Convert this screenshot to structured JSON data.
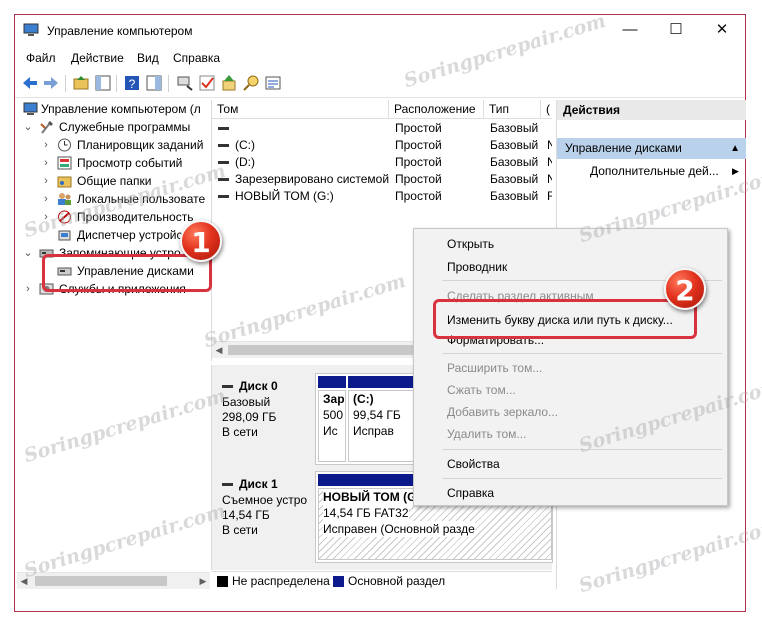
{
  "window": {
    "title": "Управление компьютером",
    "controls": {
      "minimize": "—",
      "maximize": "☐",
      "close": "✕"
    }
  },
  "menu": [
    "Файл",
    "Действие",
    "Вид",
    "Справка"
  ],
  "toolbar": {
    "icons": [
      "back-arrow-icon",
      "forward-arrow-icon",
      "up-folder-icon",
      "show-tree-icon",
      "help-icon",
      "show-pane-icon",
      "connect-icon",
      "check-icon",
      "export-icon",
      "search-icon",
      "properties-icon"
    ]
  },
  "tree": {
    "root": "Управление компьютером (л",
    "system_tools": "Служебные программы",
    "system_items": [
      "Планировщик заданий",
      "Просмотр событий",
      "Общие папки",
      "Локальные пользовате",
      "Производительность",
      "Диспетчер устройств"
    ],
    "storage": "Запоминающие устро",
    "disk_management": "Управление дисками",
    "services": "Службы и приложения"
  },
  "volumes": {
    "columns": [
      "Том",
      "Расположение",
      "Тип",
      "("
    ],
    "rows": [
      {
        "name": "",
        "location": "Простой",
        "type": "Базовый",
        "fs": ""
      },
      {
        "name": "(C:)",
        "location": "Простой",
        "type": "Базовый",
        "fs": "N"
      },
      {
        "name": "(D:)",
        "location": "Простой",
        "type": "Базовый",
        "fs": "N"
      },
      {
        "name": "Зарезервировано системой",
        "location": "Простой",
        "type": "Базовый",
        "fs": "N"
      },
      {
        "name": "НОВЫЙ ТОМ (G:)",
        "location": "Простой",
        "type": "Базовый",
        "fs": "F"
      }
    ]
  },
  "disks": [
    {
      "name": "Диск 0",
      "type": "Базовый",
      "size": "298,09 ГБ",
      "status": "В сети",
      "partitions": [
        {
          "l1": "Зар",
          "l2": "500",
          "l3": "Ис"
        },
        {
          "l1": "(C:)",
          "l2": "99,54 ГБ",
          "l3": "Исправ"
        }
      ]
    },
    {
      "name": "Диск 1",
      "type": "Съемное устро",
      "size": "14,54 ГБ",
      "status": "В сети",
      "partitions": [
        {
          "l1": "НОВЫЙ ТОМ  (G",
          "l2": "14,54 ГБ FAT32",
          "l3": "Исправен (Основной разде"
        }
      ]
    }
  ],
  "legend": {
    "unallocated": "Не распределена",
    "primary": "Основной раздел"
  },
  "actions": {
    "title": "Действия",
    "section": "Управление дисками",
    "more": "Дополнительные дей..."
  },
  "context_menu": {
    "open": "Открыть",
    "explore": "Проводник",
    "mark_active": "Сделать раздел активным",
    "change_letter": "Изменить букву диска или путь к диску...",
    "format": "Форматировать...",
    "extend": "Расширить том...",
    "shrink": "Сжать том...",
    "mirror": "Добавить зеркало...",
    "delete": "Удалить том...",
    "properties": "Свойства",
    "help": "Справка"
  },
  "badges": [
    "1",
    "2"
  ],
  "watermark": "Soringpcrepair.com",
  "colors": {
    "primary_partition": "#0d1a8c",
    "highlight": "#d9323f",
    "actions_selected": "#b9d1ea"
  }
}
